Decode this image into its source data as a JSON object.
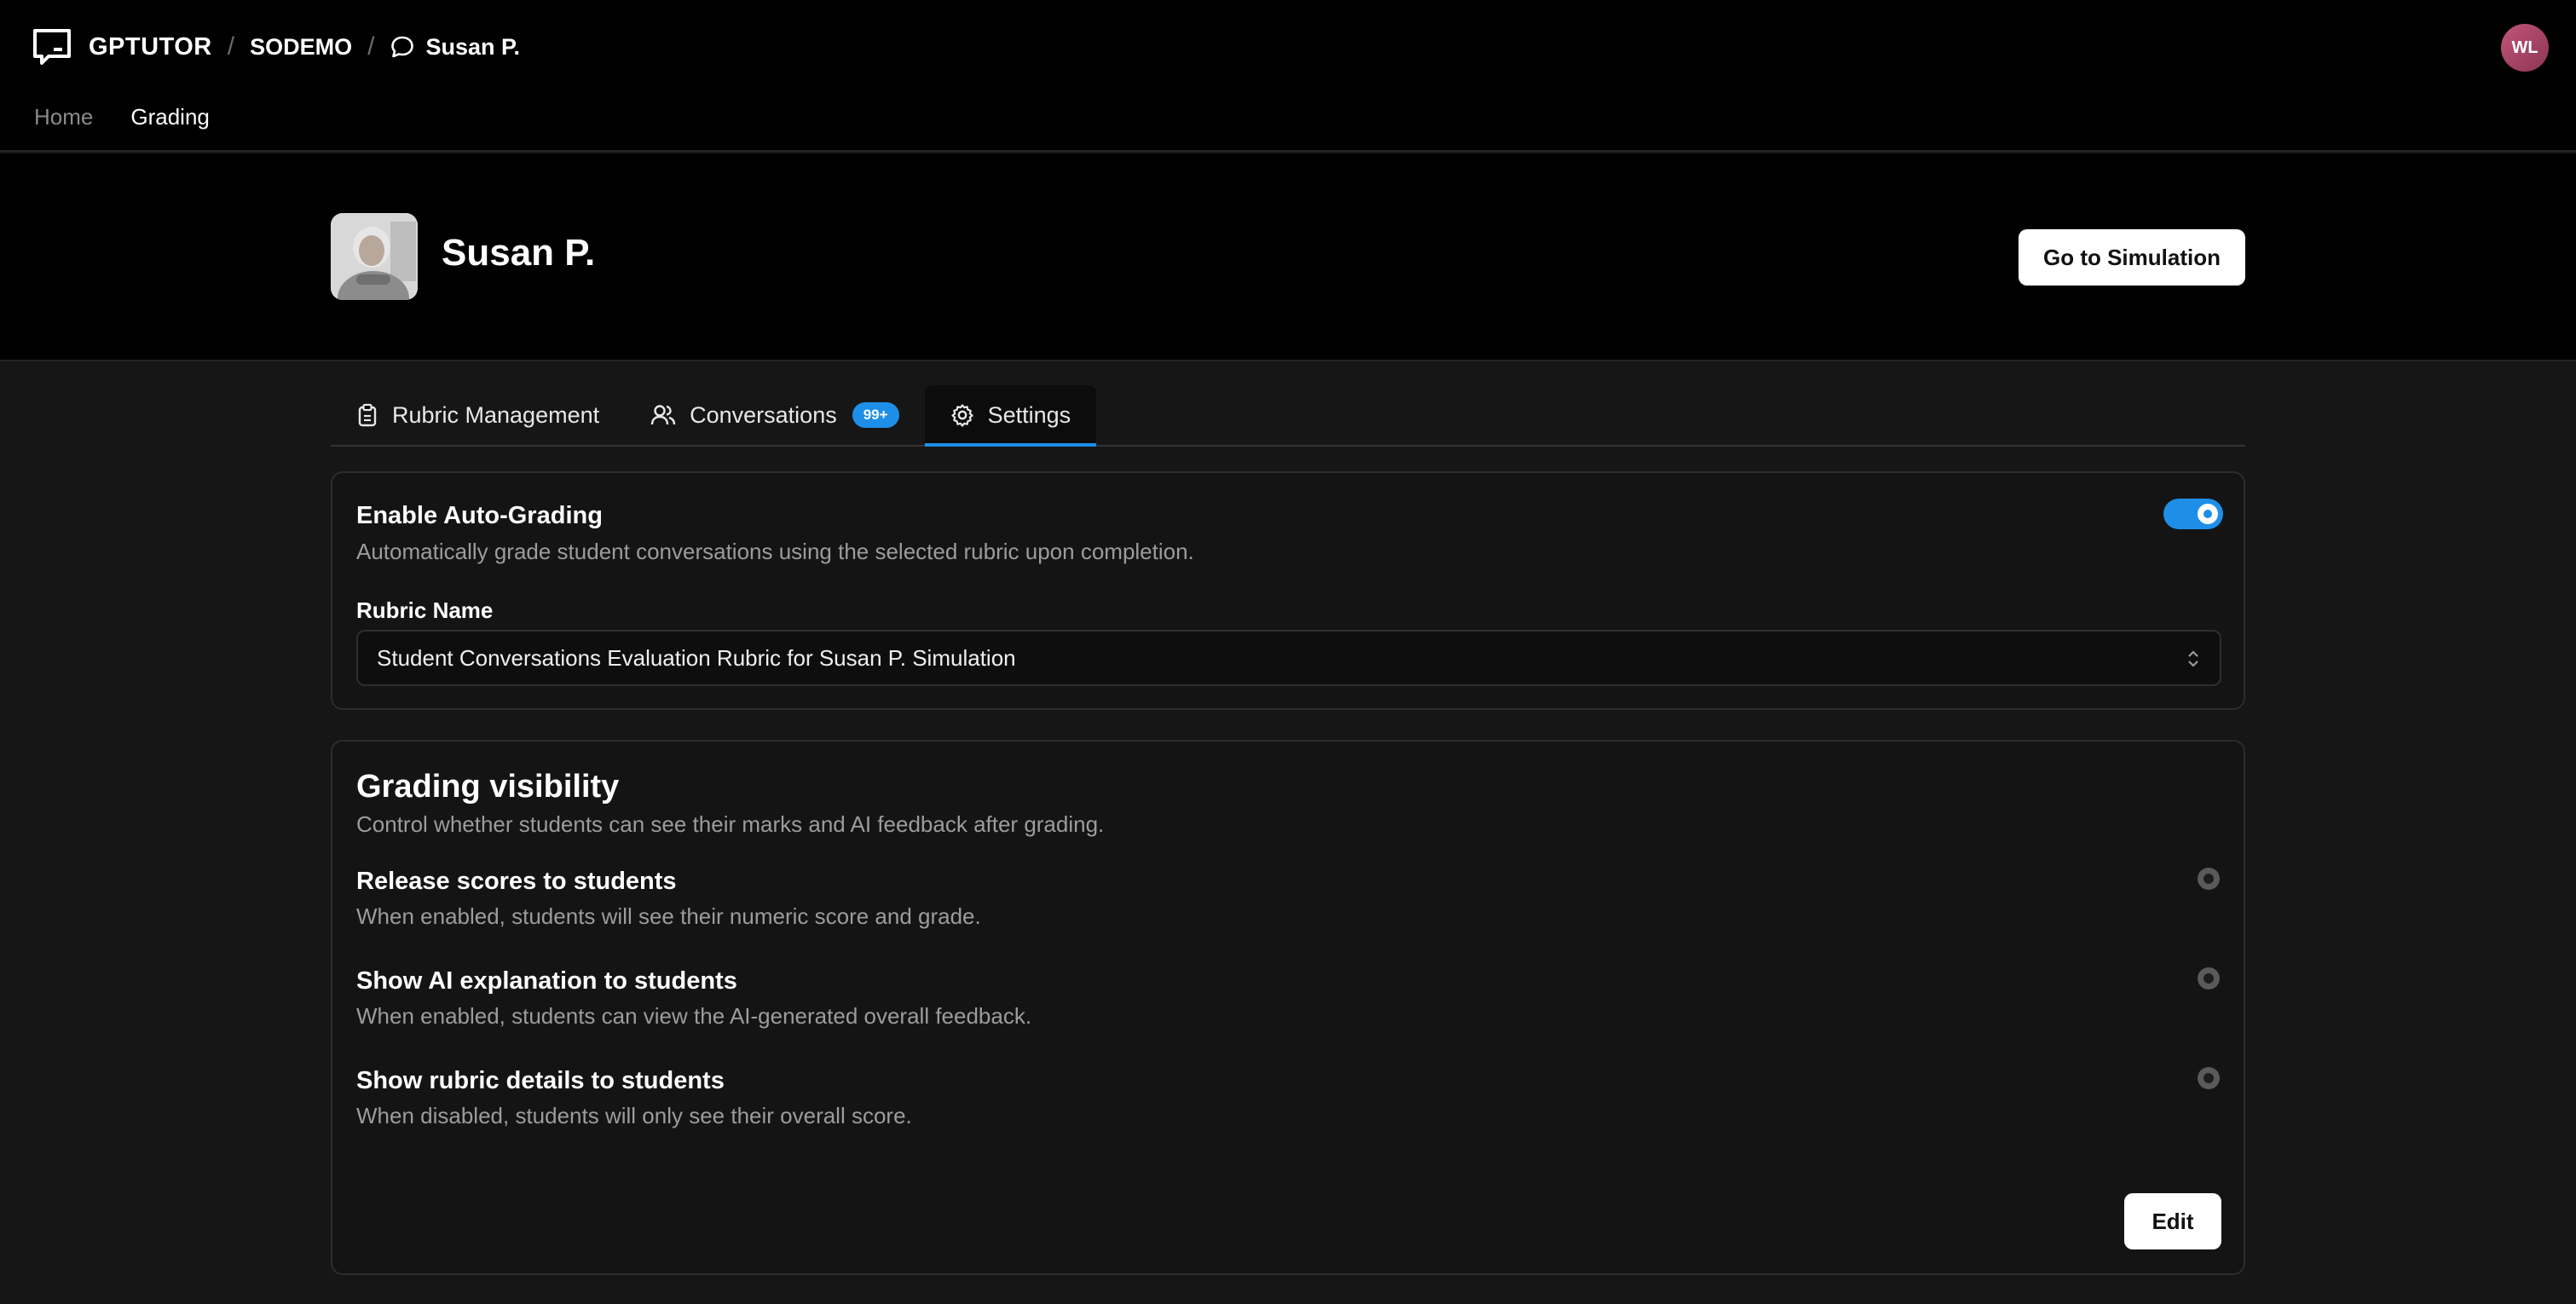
{
  "header": {
    "brand": "GPTUTOR",
    "breadcrumb": {
      "org": "SODEMO",
      "simulation": "Susan P."
    },
    "avatar_initials": "WL",
    "nav": {
      "home": "Home",
      "grading": "Grading"
    }
  },
  "hero": {
    "title": "Susan P.",
    "go_button": "Go to Simulation"
  },
  "tabs": {
    "rubric": "Rubric Management",
    "conversations": "Conversations",
    "conversations_badge": "99+",
    "settings": "Settings"
  },
  "auto_grading": {
    "title": "Enable Auto-Grading",
    "description": "Automatically grade student conversations using the selected rubric upon completion.",
    "enabled": true,
    "rubric_label": "Rubric Name",
    "rubric_value": "Student Conversations Evaluation Rubric for Susan P. Simulation"
  },
  "visibility": {
    "title": "Grading visibility",
    "description": "Control whether students can see their marks and AI feedback after grading.",
    "options": [
      {
        "title": "Release scores to students",
        "description": "When enabled, students will see their numeric score and grade."
      },
      {
        "title": "Show AI explanation to students",
        "description": "When enabled, students can view the AI-generated overall feedback."
      },
      {
        "title": "Show rubric details to students",
        "description": "When disabled, students will only see their overall score."
      }
    ],
    "edit_button": "Edit"
  },
  "colors": {
    "accent": "#1d8fe8",
    "background": "#161616",
    "header": "#000000"
  }
}
